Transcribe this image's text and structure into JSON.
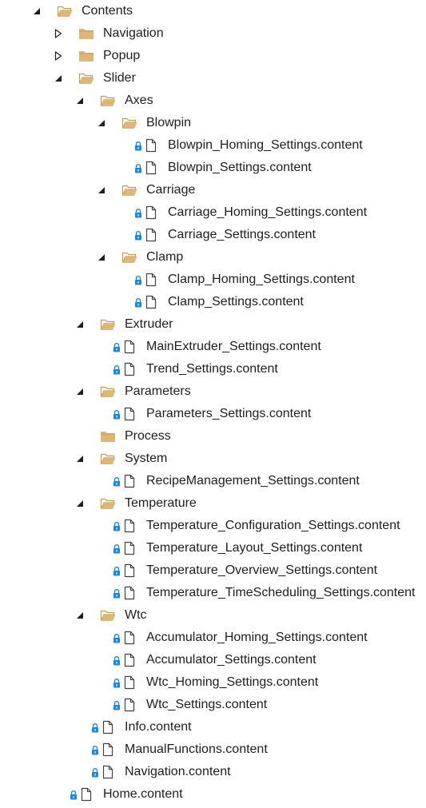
{
  "tree": {
    "rows": [
      {
        "label": "Contents",
        "level": 0,
        "kind": "folder",
        "state": "open",
        "locked": false
      },
      {
        "label": "Navigation",
        "level": 1,
        "kind": "folder",
        "state": "closed",
        "locked": false
      },
      {
        "label": "Popup",
        "level": 1,
        "kind": "folder",
        "state": "closed",
        "locked": false
      },
      {
        "label": "Slider",
        "level": 1,
        "kind": "folder",
        "state": "open",
        "locked": false
      },
      {
        "label": "Axes",
        "level": 2,
        "kind": "folder",
        "state": "open",
        "locked": false
      },
      {
        "label": "Blowpin",
        "level": 3,
        "kind": "folder",
        "state": "open",
        "locked": false
      },
      {
        "label": "Blowpin_Homing_Settings.content",
        "level": 4,
        "kind": "file",
        "locked": true
      },
      {
        "label": "Blowpin_Settings.content",
        "level": 4,
        "kind": "file",
        "locked": true
      },
      {
        "label": "Carriage",
        "level": 3,
        "kind": "folder",
        "state": "open",
        "locked": false
      },
      {
        "label": "Carriage_Homing_Settings.content",
        "level": 4,
        "kind": "file",
        "locked": true
      },
      {
        "label": "Carriage_Settings.content",
        "level": 4,
        "kind": "file",
        "locked": true
      },
      {
        "label": "Clamp",
        "level": 3,
        "kind": "folder",
        "state": "open",
        "locked": false
      },
      {
        "label": "Clamp_Homing_Settings.content",
        "level": 4,
        "kind": "file",
        "locked": true
      },
      {
        "label": "Clamp_Settings.content",
        "level": 4,
        "kind": "file",
        "locked": true
      },
      {
        "label": "Extruder",
        "level": 2,
        "kind": "folder",
        "state": "open",
        "locked": false
      },
      {
        "label": "MainExtruder_Settings.content",
        "level": 3,
        "kind": "file",
        "locked": true
      },
      {
        "label": "Trend_Settings.content",
        "level": 3,
        "kind": "file",
        "locked": true
      },
      {
        "label": "Parameters",
        "level": 2,
        "kind": "folder",
        "state": "open",
        "locked": false
      },
      {
        "label": "Parameters_Settings.content",
        "level": 3,
        "kind": "file",
        "locked": true
      },
      {
        "label": "Process",
        "level": 2,
        "kind": "folder",
        "state": "none",
        "locked": false
      },
      {
        "label": "System",
        "level": 2,
        "kind": "folder",
        "state": "open",
        "locked": false
      },
      {
        "label": "RecipeManagement_Settings.content",
        "level": 3,
        "kind": "file",
        "locked": true
      },
      {
        "label": "Temperature",
        "level": 2,
        "kind": "folder",
        "state": "open",
        "locked": false
      },
      {
        "label": "Temperature_Configuration_Settings.content",
        "level": 3,
        "kind": "file",
        "locked": true
      },
      {
        "label": "Temperature_Layout_Settings.content",
        "level": 3,
        "kind": "file",
        "locked": true
      },
      {
        "label": "Temperature_Overview_Settings.content",
        "level": 3,
        "kind": "file",
        "locked": true
      },
      {
        "label": "Temperature_TimeScheduling_Settings.content",
        "level": 3,
        "kind": "file",
        "locked": true
      },
      {
        "label": "Wtc",
        "level": 2,
        "kind": "folder",
        "state": "open",
        "locked": false
      },
      {
        "label": "Accumulator_Homing_Settings.content",
        "level": 3,
        "kind": "file",
        "locked": true
      },
      {
        "label": "Accumulator_Settings.content",
        "level": 3,
        "kind": "file",
        "locked": true
      },
      {
        "label": "Wtc_Homing_Settings.content",
        "level": 3,
        "kind": "file",
        "locked": true
      },
      {
        "label": "Wtc_Settings.content",
        "level": 3,
        "kind": "file",
        "locked": true
      },
      {
        "label": "Info.content",
        "level": 2,
        "kind": "file",
        "locked": true
      },
      {
        "label": "ManualFunctions.content",
        "level": 2,
        "kind": "file",
        "locked": true
      },
      {
        "label": "Navigation.content",
        "level": 2,
        "kind": "file",
        "locked": true
      },
      {
        "label": "Home.content",
        "level": 1,
        "kind": "file",
        "locked": true
      }
    ]
  },
  "colors": {
    "folder_fill": "#dcb67a",
    "folder_dark": "#c69c5c",
    "file_stroke": "#424242",
    "lock_blue": "#1e88d6",
    "expander_stroke": "#1e1e1e",
    "text": "#1e1e1e"
  },
  "icons": {
    "expander_open": "triangle-down-right-icon",
    "expander_closed": "triangle-right-outline-icon",
    "folder_open": "folder-open-icon",
    "folder_closed": "folder-closed-icon",
    "file": "document-icon",
    "lock": "lock-icon"
  }
}
